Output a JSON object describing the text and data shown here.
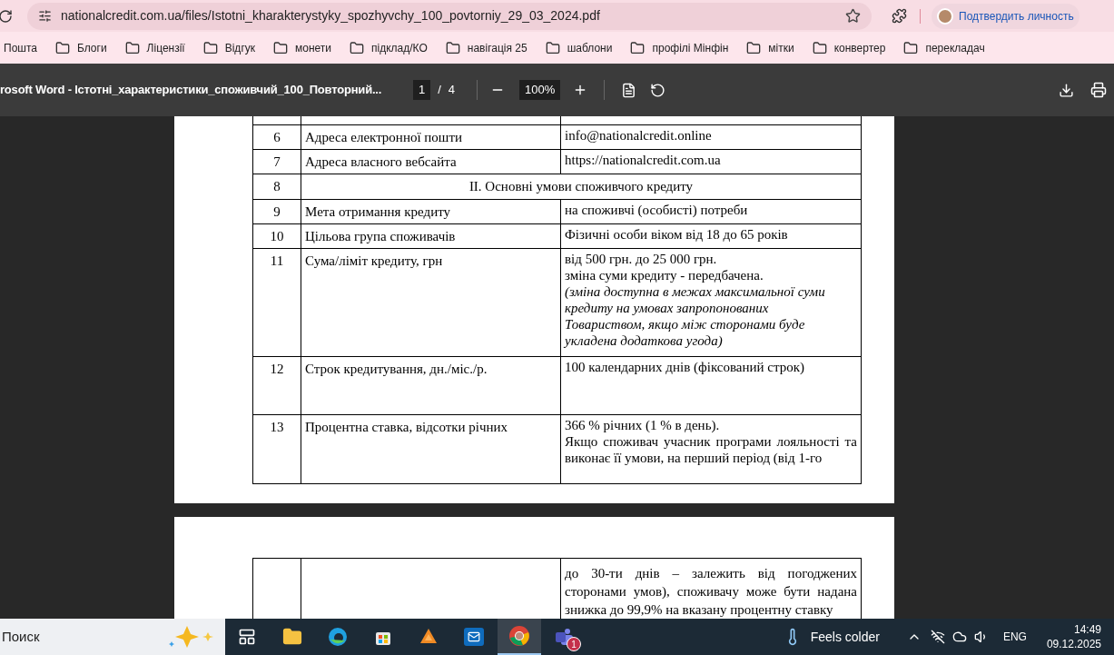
{
  "browser": {
    "url": "nationalcredit.com.ua/files/Istotni_kharakterystyky_spozhyvchy_100_povtorniy_29_03_2024.pdf",
    "profile_button": "Подтвердить личность",
    "bookmarks": [
      {
        "label": "Пошта",
        "kind": "plain"
      },
      {
        "label": "Блоги",
        "kind": "folder"
      },
      {
        "label": "Ліцензії",
        "kind": "folder"
      },
      {
        "label": "Відгук",
        "kind": "folder"
      },
      {
        "label": "монети",
        "kind": "folder"
      },
      {
        "label": "підклад/КО",
        "kind": "folder"
      },
      {
        "label": "навігація 25",
        "kind": "folder"
      },
      {
        "label": "шаблони",
        "kind": "folder"
      },
      {
        "label": "профілі Мінфін",
        "kind": "folder"
      },
      {
        "label": "мітки",
        "kind": "folder"
      },
      {
        "label": "конвертер",
        "kind": "folder"
      },
      {
        "label": "перекладач",
        "kind": "folder"
      }
    ]
  },
  "pdf_toolbar": {
    "title": "rosoft Word - Істотні_характеристики_споживчий_100_Повторний...",
    "page_current": "1",
    "page_separator": "/",
    "page_total": "4",
    "zoom": "100%"
  },
  "page_1": {
    "rows": [
      {
        "kind": "row",
        "number": "6",
        "label": "Адреса електронної пошти",
        "value": [
          "info@nationalcredit.online"
        ]
      },
      {
        "kind": "row",
        "number": "7",
        "label": "Адреса власного вебсайта",
        "value": [
          "https://nationalcredit.com.ua"
        ]
      },
      {
        "kind": "section",
        "number": "8",
        "label": "II. Основні умови споживчого кредиту"
      },
      {
        "kind": "row",
        "number": "9",
        "label": "Мета отримання кредиту",
        "value": [
          "на споживчі (особисті) потреби"
        ]
      },
      {
        "kind": "row",
        "number": "10",
        "label": "Цільова група споживачів",
        "value": [
          "Фізичні особи віком від 18 до 65 років"
        ]
      },
      {
        "kind": "row",
        "number": "11",
        "label": "Сума/ліміт кредиту, грн",
        "value": [
          "від 500 грн. до 25 000 грн.",
          "зміна суми кредиту - передбачена."
        ],
        "note": "(зміна доступна в межах максимальної  суми кредиту на умовах запропонованих Товариством, якщо між сторонами буде укладена додаткова угода)"
      },
      {
        "kind": "row",
        "number": "12",
        "label": "Строк кредитування, дн./міс./р.",
        "value": [
          "100 календарних днів (фіксований строк)"
        ]
      },
      {
        "kind": "row",
        "number": "13",
        "label": "Процентна ставка, відсотки річних",
        "value": [
          "366 % річних (1 % в день).",
          "Якщо споживач учасник програми лояльності та виконає її умови, на перший період (від 1-го"
        ]
      }
    ]
  },
  "page_2": {
    "rows": [
      {
        "kind": "continuation",
        "value": [
          "до 30-ти днів – залежить від погоджених сторонами умов), споживачу може бути надана знижка до 99,9% на вказану процентну ставку"
        ]
      }
    ]
  },
  "taskbar": {
    "search": "Поиск",
    "apps": [
      {
        "kind": "taskview",
        "selected": false
      },
      {
        "kind": "explorer",
        "selected": false
      },
      {
        "kind": "edge",
        "selected": false
      },
      {
        "kind": "store",
        "selected": false
      },
      {
        "kind": "orange",
        "selected": false
      },
      {
        "kind": "outlook",
        "selected": false
      },
      {
        "kind": "chrome",
        "selected": true
      },
      {
        "kind": "teams",
        "selected": false,
        "badge": "1"
      }
    ],
    "weather": "Feels colder",
    "language": "ENG",
    "time": "14:49",
    "date": "09.12.2025"
  }
}
